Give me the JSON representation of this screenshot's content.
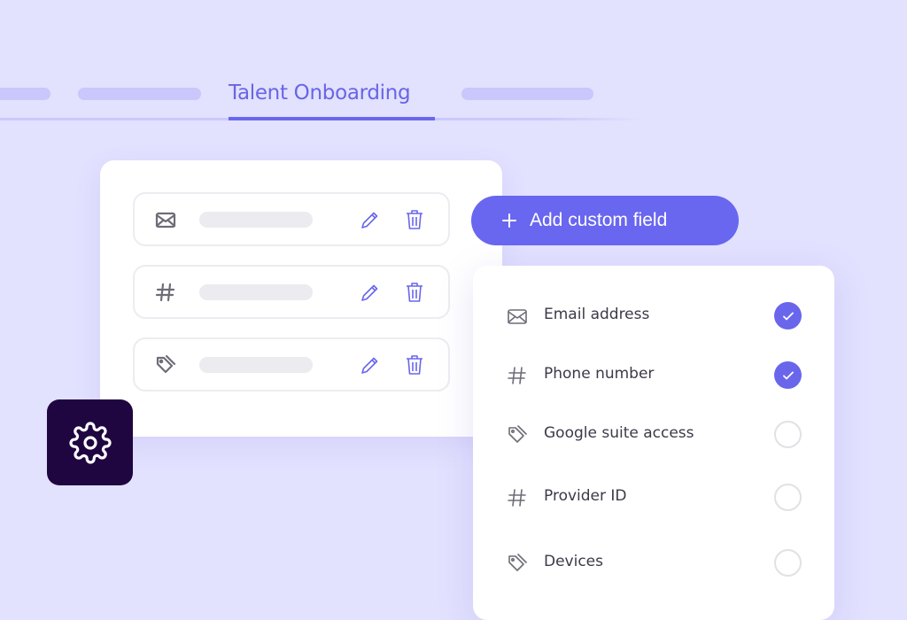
{
  "tabs": {
    "active_label": "Talent Onboarding"
  },
  "field_rows": [
    {
      "icon": "mail-icon"
    },
    {
      "icon": "hash-icon"
    },
    {
      "icon": "tag-icon"
    }
  ],
  "add_button": {
    "label": "Add custom field",
    "icon": "plus-icon"
  },
  "options": [
    {
      "label": "Email address",
      "icon": "mail-icon",
      "checked": true
    },
    {
      "label": "Phone number",
      "icon": "hash-icon",
      "checked": true
    },
    {
      "label": "Google suite access",
      "icon": "tag-icon",
      "checked": false
    },
    {
      "label": "Provider ID",
      "icon": "hash-icon",
      "checked": false
    },
    {
      "label": "Devices",
      "icon": "tag-icon",
      "checked": false
    }
  ],
  "colors": {
    "accent": "#6966f0",
    "background": "#e2e1fe",
    "gear_tile": "#1f0641"
  }
}
